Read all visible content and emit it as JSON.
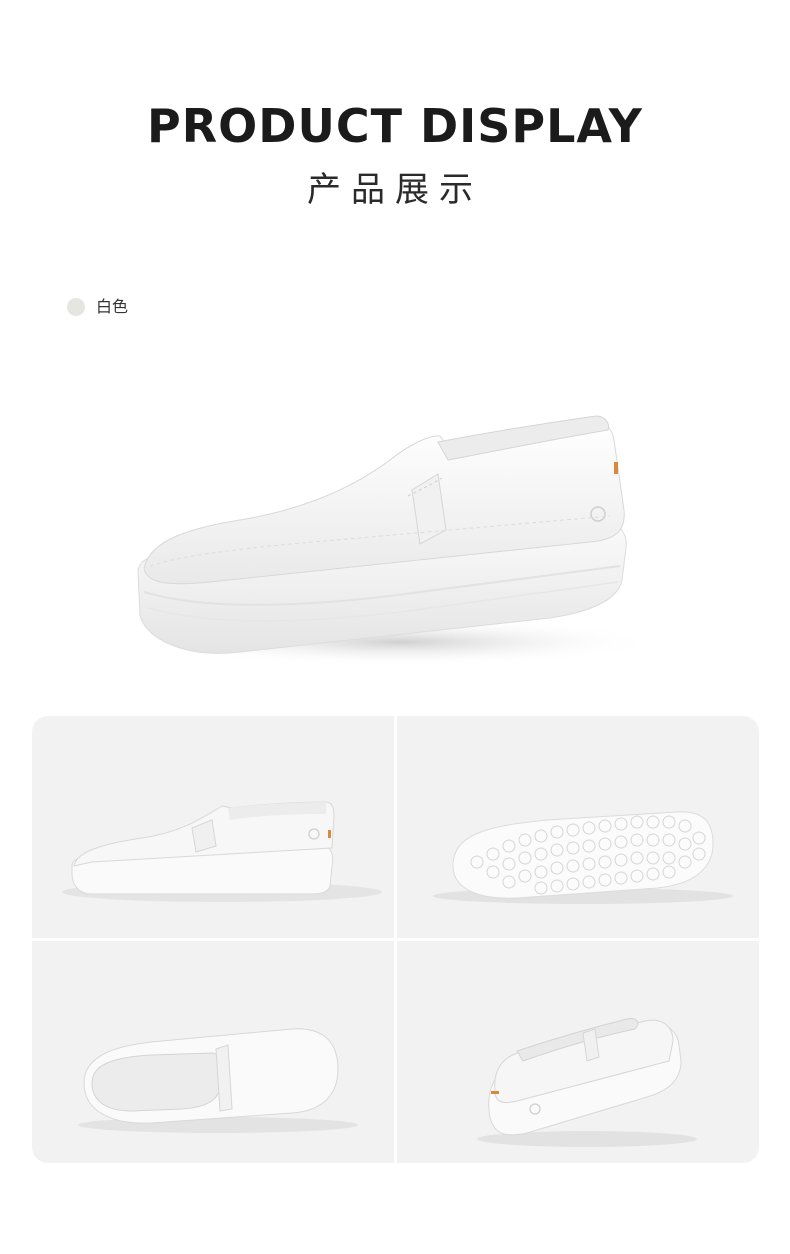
{
  "header": {
    "title_en": "PRODUCT DISPLAY",
    "title_cn": "产品展示"
  },
  "color_option": {
    "label": "白色",
    "swatch_color": "#e6e6e1"
  },
  "images": {
    "hero": "white-slip-on-sneaker-hero",
    "tiles": [
      "side-view",
      "outsole-view",
      "top-view",
      "rear-three-quarter-view"
    ]
  },
  "colors": {
    "tile_background": "#f2f2f2",
    "shoe_white": "#f7f7f7",
    "accent_tab": "#d9893a"
  }
}
